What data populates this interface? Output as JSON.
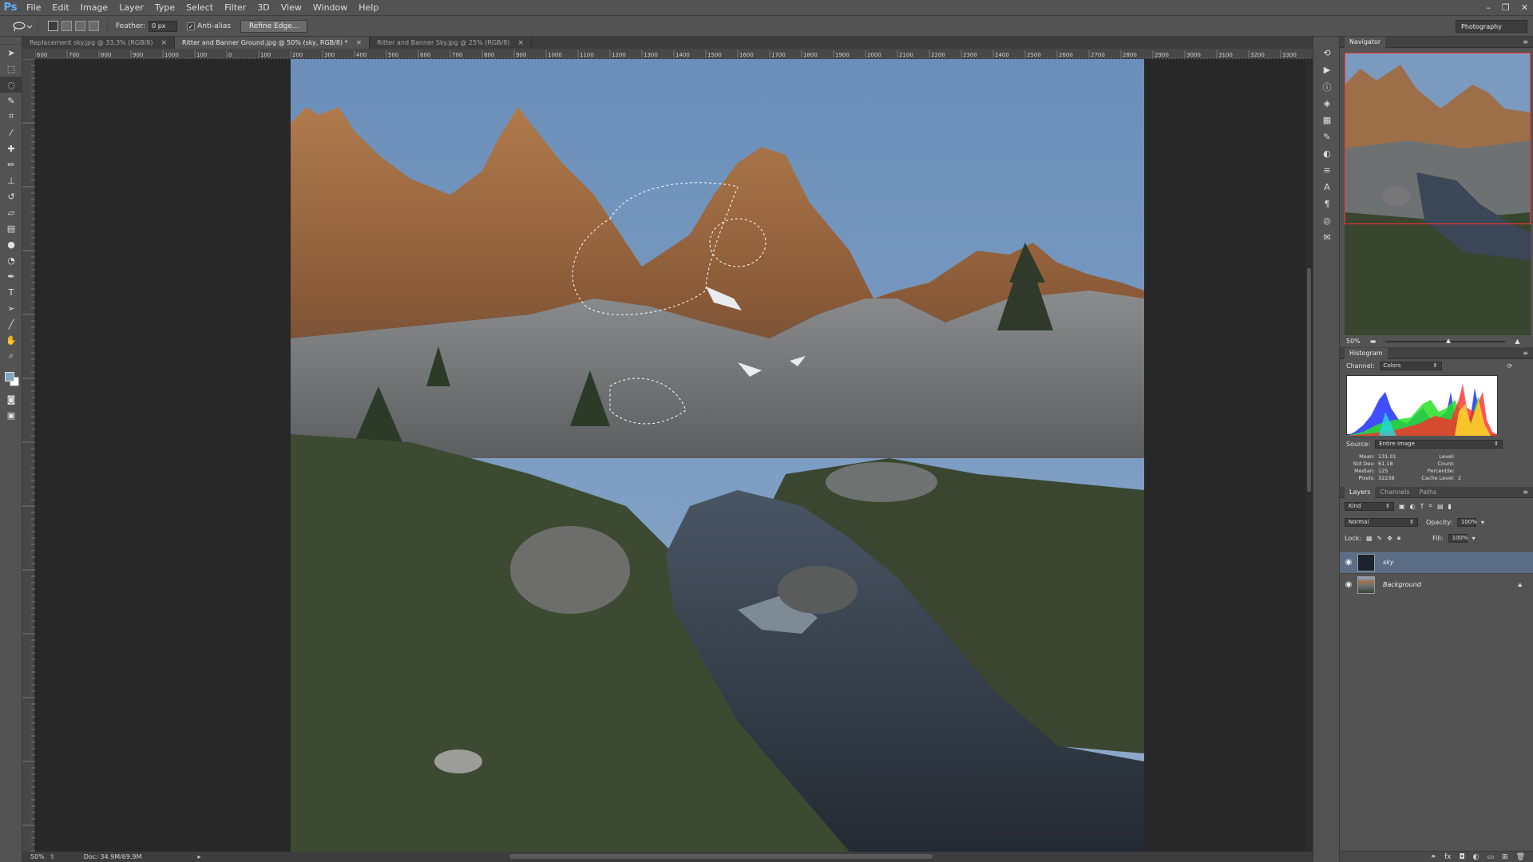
{
  "app": {
    "logo": "Ps",
    "menu": [
      "File",
      "Edit",
      "Image",
      "Layer",
      "Type",
      "Select",
      "Filter",
      "3D",
      "View",
      "Window",
      "Help"
    ],
    "window_controls": [
      "–",
      "❐",
      "✕"
    ]
  },
  "options": {
    "feather_label": "Feather:",
    "feather_value": "0 px",
    "antialias_label": "Anti-alias",
    "antialias_checked": "✓",
    "refine_edge_label": "Refine Edge...",
    "workspace": "Photography"
  },
  "tabs": [
    {
      "title": "Replacement sky.jpg @ 33.3% (RGB/8)",
      "close": "×"
    },
    {
      "title": "Ritter and Banner Ground.jpg @ 50% (sky, RGB/8) *",
      "close": "×"
    },
    {
      "title": "Ritter and Banner Sky.jpg @ 25% (RGB/8)",
      "close": "×"
    }
  ],
  "ruler_top_labels": [
    "600",
    "700",
    "800",
    "900",
    "1000",
    "100",
    "0",
    "100",
    "200",
    "300",
    "400",
    "500",
    "600",
    "700",
    "800",
    "900",
    "1000",
    "1100",
    "1200",
    "1300",
    "1400",
    "1500",
    "1600",
    "1700",
    "1800",
    "1900",
    "2000",
    "2100",
    "2200",
    "2300",
    "2400",
    "2500",
    "2600",
    "2700",
    "2800",
    "2900",
    "3000",
    "3100",
    "3200",
    "3300"
  ],
  "status": {
    "zoom": "50%",
    "doc_size": "Doc: 34.9M/69.9M"
  },
  "navigator": {
    "title": "Navigator",
    "zoom": "50%"
  },
  "histogram": {
    "title": "Histogram",
    "channel_label": "Channel:",
    "channel_value": "Colors",
    "source_label": "Source:",
    "source_value": "Entire Image",
    "stats": [
      {
        "label": "Mean:",
        "value": "131.01",
        "label2": "Level:",
        "value2": ""
      },
      {
        "label": "Std Dev:",
        "value": "61.18",
        "label2": "Count:",
        "value2": ""
      },
      {
        "label": "Median:",
        "value": "125",
        "label2": "Percentile:",
        "value2": ""
      },
      {
        "label": "Pixels:",
        "value": "32238",
        "label2": "Cache Level:",
        "value2": "2"
      }
    ]
  },
  "layers_panel": {
    "tabs": [
      "Layers",
      "Channels",
      "Paths"
    ],
    "kind_label": "Kind",
    "blend_mode": "Normal",
    "opacity_label": "Opacity:",
    "opacity_value": "100%",
    "lock_label": "Lock:",
    "fill_label": "Fill:",
    "fill_value": "100%",
    "layers": [
      {
        "name": "sky",
        "selected": true
      },
      {
        "name": "Background",
        "selected": false
      }
    ]
  },
  "colors": {
    "foreground": "#7fa3c6",
    "background": "#ffffff",
    "selection_highlight": "#5b6e85"
  }
}
